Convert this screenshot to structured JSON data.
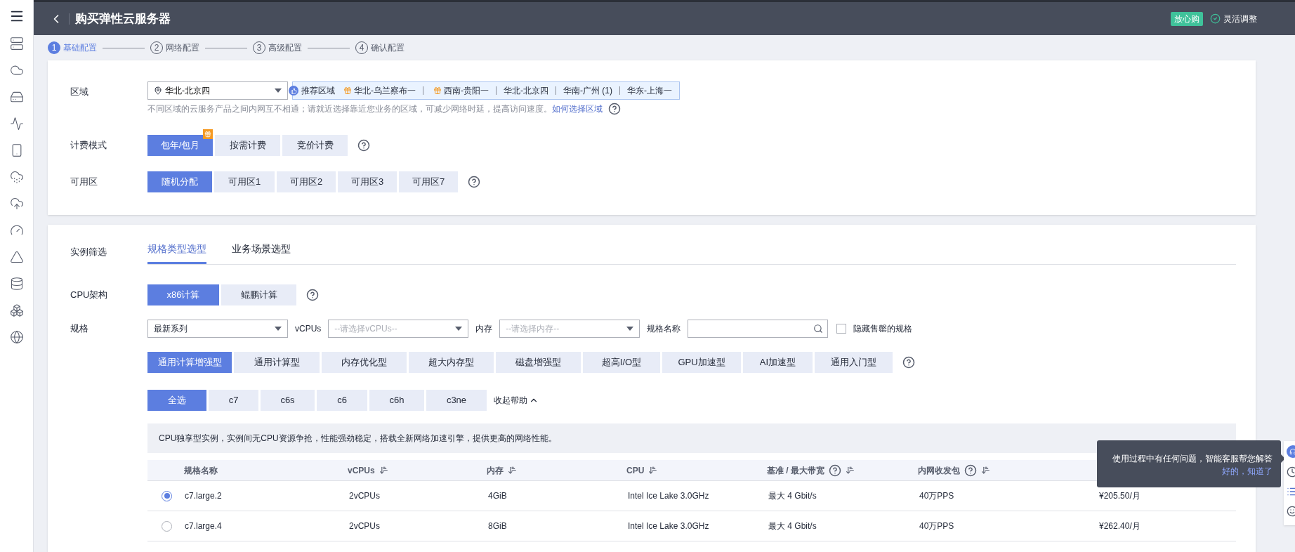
{
  "header": {
    "title": "购买弹性云服务器",
    "badge": "放心购",
    "flex_label": "灵活调整"
  },
  "steps": [
    {
      "number": "1",
      "label": "基础配置",
      "selected": true
    },
    {
      "number": "2",
      "label": "网络配置",
      "selected": false
    },
    {
      "number": "3",
      "label": "高级配置",
      "selected": false
    },
    {
      "number": "4",
      "label": "确认配置",
      "selected": false
    }
  ],
  "region": {
    "label": "区域",
    "value": "华北-北京四",
    "recommend_label": "推荐区域",
    "recommended": [
      {
        "name": "华北-乌兰察布一",
        "gift": true
      },
      {
        "name": "西南-贵阳一",
        "gift": true
      },
      {
        "name": "华北-北京四",
        "gift": false
      },
      {
        "name": "华南-广州 (1)",
        "gift": false
      },
      {
        "name": "华东-上海一",
        "gift": false
      }
    ],
    "hint": "不同区域的云服务产品之间内网互不相通；请就近选择靠近您业务的区域，可减少网络时延，提高访问速度。",
    "hint_link": "如何选择区域"
  },
  "billing": {
    "label": "计费模式",
    "options": [
      {
        "label": "包年/包月",
        "selected": true,
        "gift": true
      },
      {
        "label": "按需计费",
        "selected": false,
        "gift": false
      },
      {
        "label": "竞价计费",
        "selected": false,
        "gift": false
      }
    ]
  },
  "zone": {
    "label": "可用区",
    "options": [
      {
        "label": "随机分配",
        "selected": true
      },
      {
        "label": "可用区1",
        "selected": false
      },
      {
        "label": "可用区2",
        "selected": false
      },
      {
        "label": "可用区3",
        "selected": false
      },
      {
        "label": "可用区7",
        "selected": false
      }
    ]
  },
  "filter": {
    "label": "实例筛选",
    "tabs": [
      {
        "label": "规格类型选型",
        "selected": true
      },
      {
        "label": "业务场景选型",
        "selected": false
      }
    ]
  },
  "cpu_arch": {
    "label": "CPU架构",
    "options": [
      {
        "label": "x86计算",
        "selected": true
      },
      {
        "label": "鲲鹏计算",
        "selected": false
      }
    ]
  },
  "spec": {
    "label": "规格",
    "series": "最新系列",
    "vcpus_label": "vCPUs",
    "vcpus_placeholder": "--请选择vCPUs--",
    "memory_label": "内存",
    "memory_placeholder": "--请选择内存--",
    "name_label": "规格名称",
    "hide_label": "隐藏售罄的规格",
    "hide_checked": false,
    "types": [
      {
        "label": "通用计算增强型",
        "selected": true
      },
      {
        "label": "通用计算型",
        "selected": false
      },
      {
        "label": "内存优化型",
        "selected": false
      },
      {
        "label": "超大内存型",
        "selected": false
      },
      {
        "label": "磁盘增强型",
        "selected": false
      },
      {
        "label": "超高I/O型",
        "selected": false
      },
      {
        "label": "GPU加速型",
        "selected": false
      },
      {
        "label": "AI加速型",
        "selected": false
      },
      {
        "label": "通用入门型",
        "selected": false
      }
    ],
    "families": [
      {
        "label": "全选",
        "selected": true
      },
      {
        "label": "c7",
        "selected": false
      },
      {
        "label": "c6s",
        "selected": false
      },
      {
        "label": "c6",
        "selected": false
      },
      {
        "label": "c6h",
        "selected": false
      },
      {
        "label": "c3ne",
        "selected": false
      }
    ],
    "collapse_help": "收起帮助"
  },
  "help_text": "CPU独享型实例，实例间无CPU资源争抢，性能强劲稳定，搭载全新网络加速引擎，提供更高的网络性能。",
  "table": {
    "columns": [
      {
        "label": "规格名称",
        "sortable": false,
        "help": false
      },
      {
        "label": "vCPUs",
        "sortable": true,
        "help": false
      },
      {
        "label": "内存",
        "sortable": true,
        "help": false
      },
      {
        "label": "CPU",
        "sortable": true,
        "help": false
      },
      {
        "label": "基准 / 最大带宽",
        "sortable": true,
        "help": true
      },
      {
        "label": "内网收发包",
        "sortable": true,
        "help": true
      }
    ],
    "rows": [
      {
        "selected": true,
        "cells": [
          "c7.large.2",
          "2vCPUs",
          "4GiB",
          "Intel Ice Lake 3.0GHz",
          "最大 4 Gbit/s",
          "40万PPS",
          "¥205.50/月"
        ]
      },
      {
        "selected": false,
        "cells": [
          "c7.large.4",
          "2vCPUs",
          "8GiB",
          "Intel Ice Lake 3.0GHz",
          "最大 4 Gbit/s",
          "40万PPS",
          "¥262.40/月"
        ]
      }
    ]
  },
  "tooltip": {
    "text": "使用过程中有任何问题，智能客服帮您解答",
    "action": "好的，知道了"
  }
}
